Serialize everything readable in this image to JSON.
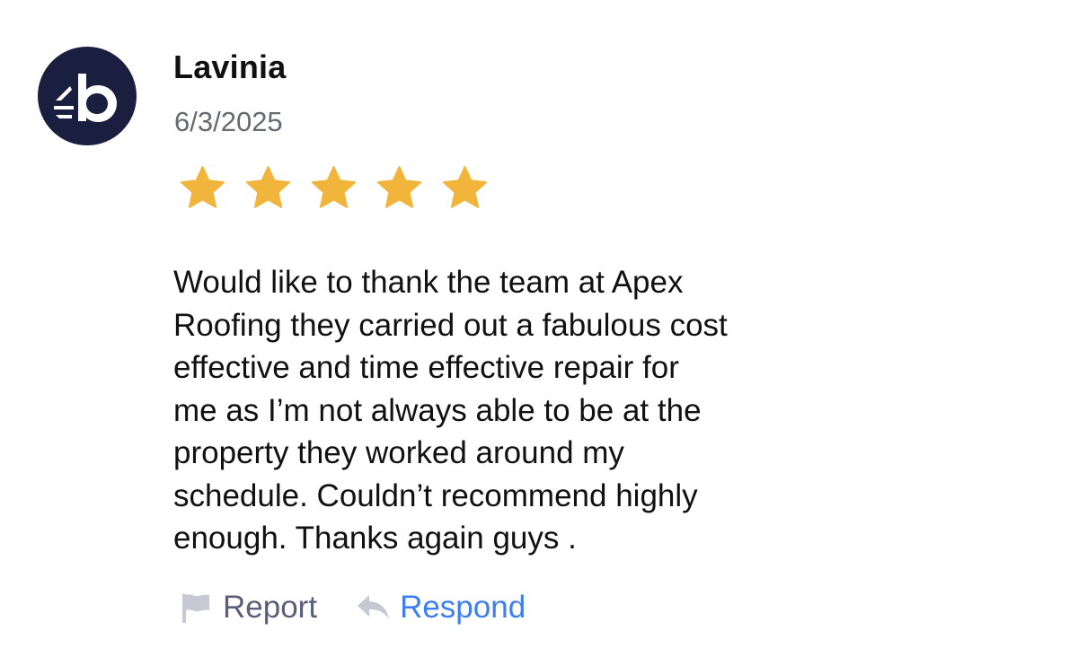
{
  "reviewer": {
    "avatar_icon": "brand-logo-icon",
    "name": "Lavinia",
    "date": "6/3/2025"
  },
  "rating": {
    "value": 5,
    "max": 5,
    "star_color": "#f2b53b"
  },
  "review": {
    "lines": [
      "Would like to thank the team at Apex",
      "Roofing they carried out a fabulous cost",
      "effective and time effective repair for",
      "me as I’m not always able to be at the",
      "property they worked around my",
      "schedule. Couldn’t recommend highly",
      "enough. Thanks again guys ."
    ]
  },
  "actions": {
    "report": {
      "icon": "flag-icon",
      "label": "Report"
    },
    "respond": {
      "icon": "reply-icon",
      "label": "Respond",
      "color": "#3d7ff0"
    }
  },
  "colors": {
    "avatar_bg": "#1a1f3f",
    "date_text": "#666a70",
    "report_text": "#5b5f7a"
  }
}
